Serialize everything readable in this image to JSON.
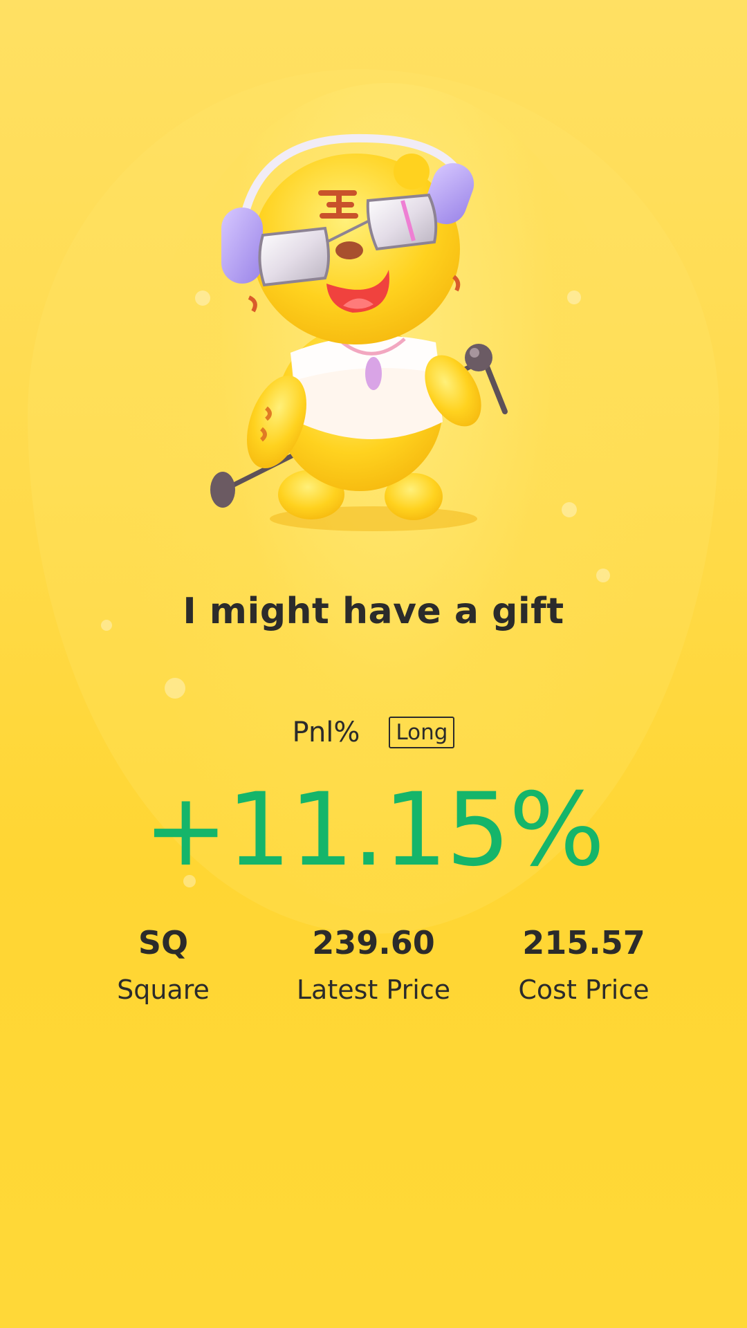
{
  "headline": "I might have a gift",
  "pnl": {
    "label": "Pnl%",
    "direction": "Long",
    "value": "+11.15%"
  },
  "stats": [
    {
      "value": "SQ",
      "label": "Square"
    },
    {
      "value": "239.60",
      "label": "Latest Price"
    },
    {
      "value": "215.57",
      "label": "Cost Price"
    }
  ],
  "colors": {
    "background": "#ffd633",
    "gain": "#15b56a",
    "text": "#2b2b2b"
  },
  "mascot": {
    "icon": "tiger-mascot-with-headphones-and-microphone-icon"
  }
}
